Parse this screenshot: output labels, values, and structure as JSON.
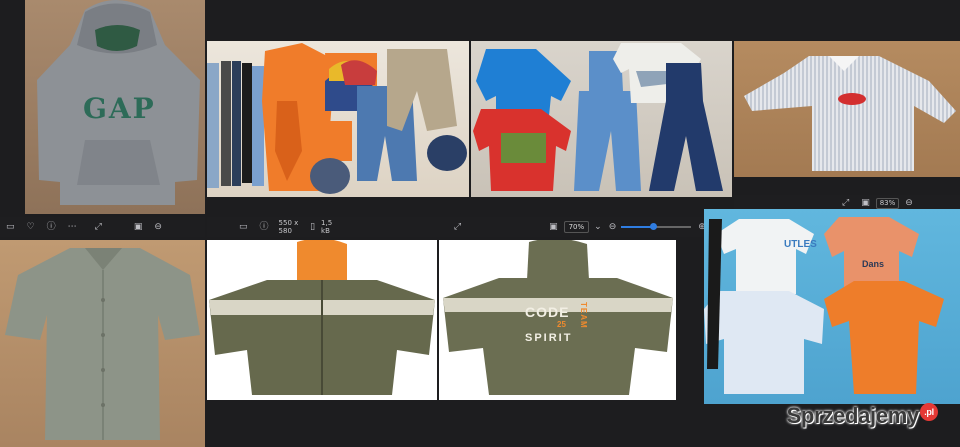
{
  "toolbar_middle": {
    "dimensions": "550 x 580",
    "file_size": "1,5 kB",
    "zoom": "70%"
  },
  "toolbar_right": {
    "zoom": "83%"
  },
  "zoom_level": 0.45,
  "photos": {
    "hoodie": {
      "logo_text": "GAP"
    },
    "jacket_back": {
      "print_line1": "CODE",
      "print_line2": "SPIRIT",
      "print_side": "TEAM",
      "print_small": "25"
    },
    "tshirts": {
      "print_text": "UTLES",
      "print_text2": "Dans"
    }
  },
  "watermark": {
    "text": "Sprzedajemy",
    "badge": ".pl"
  },
  "colors": {
    "accent": "#2f7de1",
    "toolbar": "#1e1e20",
    "watermark_badge": "#e53935"
  },
  "icons": [
    "panel-icon",
    "heart-icon",
    "info-icon",
    "more-icon",
    "fit-icon",
    "fullscreen-icon",
    "zoom-out-icon",
    "zoom-in-icon",
    "expand-icon"
  ]
}
